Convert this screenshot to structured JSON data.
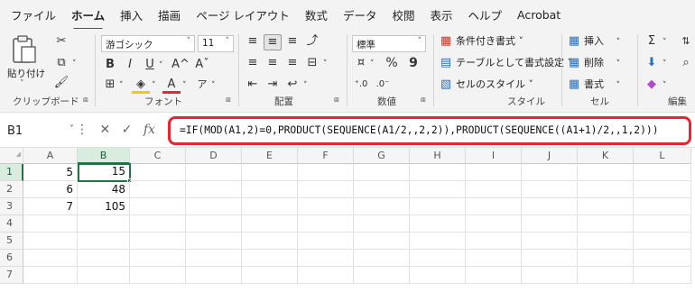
{
  "menu": {
    "items": [
      "ファイル",
      "ホーム",
      "挿入",
      "描画",
      "ページ レイアウト",
      "数式",
      "データ",
      "校閲",
      "表示",
      "ヘルプ",
      "Acrobat"
    ],
    "active": "ホーム"
  },
  "ribbon": {
    "clipboard": {
      "paste_label": "貼り付け",
      "group_label": "クリップボード"
    },
    "font": {
      "name": "游ゴシック",
      "size": "11",
      "bold": "B",
      "italic": "I",
      "underline": "U",
      "grow": "A^",
      "shrink": "Aˇ",
      "font_color": "A",
      "group_label": "フォント"
    },
    "alignment": {
      "group_label": "配置"
    },
    "number": {
      "format": "標準",
      "percent": "%",
      "comma": "9",
      "group_label": "数値"
    },
    "style": {
      "conditional": "条件付き書式 ˅",
      "table": "テーブルとして書式設定 ˅",
      "cell_style": "セルのスタイル ˅",
      "group_label": "スタイル"
    },
    "cells": {
      "insert": "挿入",
      "delete": "削除",
      "format": "書式",
      "group_label": "セル"
    },
    "editing": {
      "group_label": "編集"
    }
  },
  "formula_bar": {
    "name_box": "B1",
    "fx": "fx",
    "formula": "=IF(MOD(A1,2)=0,PRODUCT(SEQUENCE(A1/2,,2,2)),PRODUCT(SEQUENCE((A1+1)/2,,1,2)))"
  },
  "sheet": {
    "columns": [
      "A",
      "B",
      "C",
      "D",
      "E",
      "F",
      "G",
      "H",
      "I",
      "J",
      "K",
      "L"
    ],
    "rows": [
      "1",
      "2",
      "3",
      "4",
      "5",
      "6",
      "7"
    ],
    "col_a": [
      "5",
      "6",
      "7"
    ],
    "col_b": [
      "15",
      "48",
      "105"
    ],
    "active_cell": "B1"
  },
  "colors": {
    "accent": "#217346",
    "highlight_border": "#e8262f"
  }
}
